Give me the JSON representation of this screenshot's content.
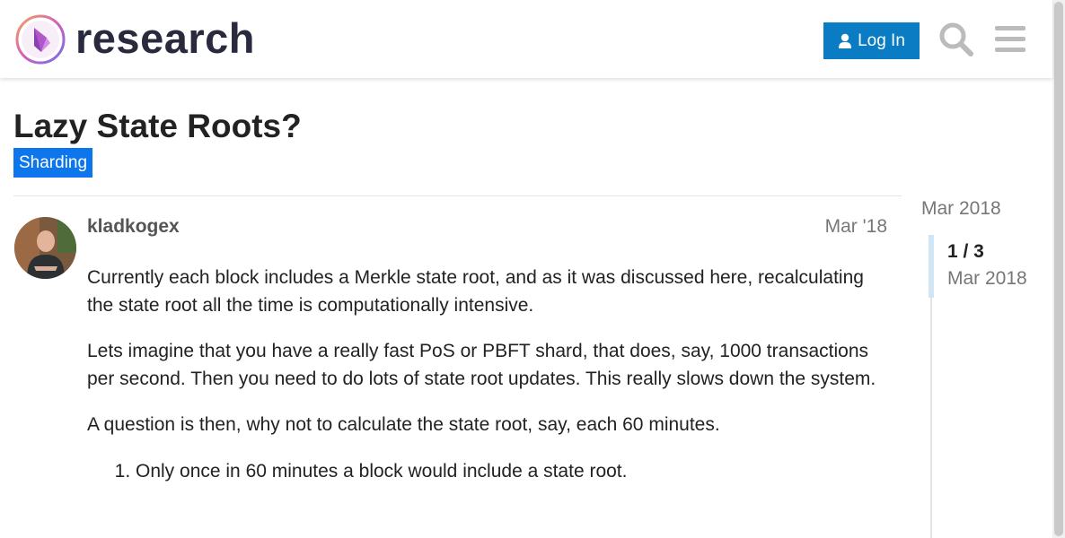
{
  "header": {
    "logo_text": "research",
    "login_label": "Log In",
    "search_icon": "search-icon",
    "menu_icon": "hamburger-menu-icon"
  },
  "topic": {
    "title": "Lazy State Roots?",
    "category": "Sharding",
    "category_color": "#0e76ec"
  },
  "post": {
    "username": "kladkogex",
    "date": "Mar '18",
    "paragraphs": [
      "Currently each block includes a Merkle state root, and as it was discussed here, recalculating the state root all the time is computationally intensive.",
      "Lets imagine that you have a really fast PoS or PBFT shard, that does, say, 1000 transactions per second. Then you need to do lots of state root updates. This really slows down the system.",
      "A question is then, why not to calculate the state root, say, each 60 minutes."
    ],
    "list_items": [
      "Only once in 60 minutes a block would include a state root."
    ]
  },
  "timeline": {
    "start_date": "Mar 2018",
    "position": "1 / 3",
    "current_date": "Mar 2018",
    "progress_fraction": 0.33
  },
  "colors": {
    "accent": "#0a7cc4",
    "tag": "#0e76ec",
    "muted_text": "#777777"
  }
}
